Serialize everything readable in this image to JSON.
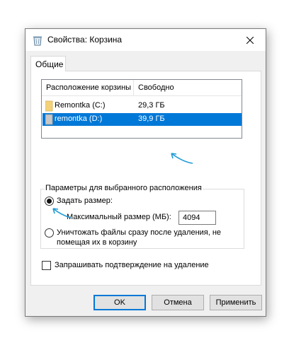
{
  "window": {
    "title": "Свойства: Корзина",
    "close_glyph": "✕"
  },
  "tabs": [
    {
      "label": "Общие",
      "active": true
    }
  ],
  "location_list": {
    "col_location": "Расположение корзины",
    "col_free": "Свободно",
    "rows": [
      {
        "name": "Remontka (C:)",
        "free": "29,3 ГБ",
        "selected": false
      },
      {
        "name": "remontka (D:)",
        "free": "39,9 ГБ",
        "selected": true
      }
    ]
  },
  "settings": {
    "group_label": "Параметры для выбранного расположения",
    "custom_size_label": "Задать размер:",
    "custom_size_checked": true,
    "max_size_label": "Максимальный размер (МБ):",
    "max_size_value": "4094",
    "delete_immediately_line1": "Уничтожать файлы сразу после удаления, не",
    "delete_immediately_line2": "помещая их в корзину",
    "delete_immediately_checked": false
  },
  "confirm_delete": {
    "label": "Запрашивать подтверждение на удаление",
    "checked": false
  },
  "buttons": {
    "ok": "OK",
    "cancel": "Отмена",
    "apply": "Применить"
  },
  "colors": {
    "selection": "#0078d7",
    "annotation_arrow": "#1f9bd6"
  }
}
